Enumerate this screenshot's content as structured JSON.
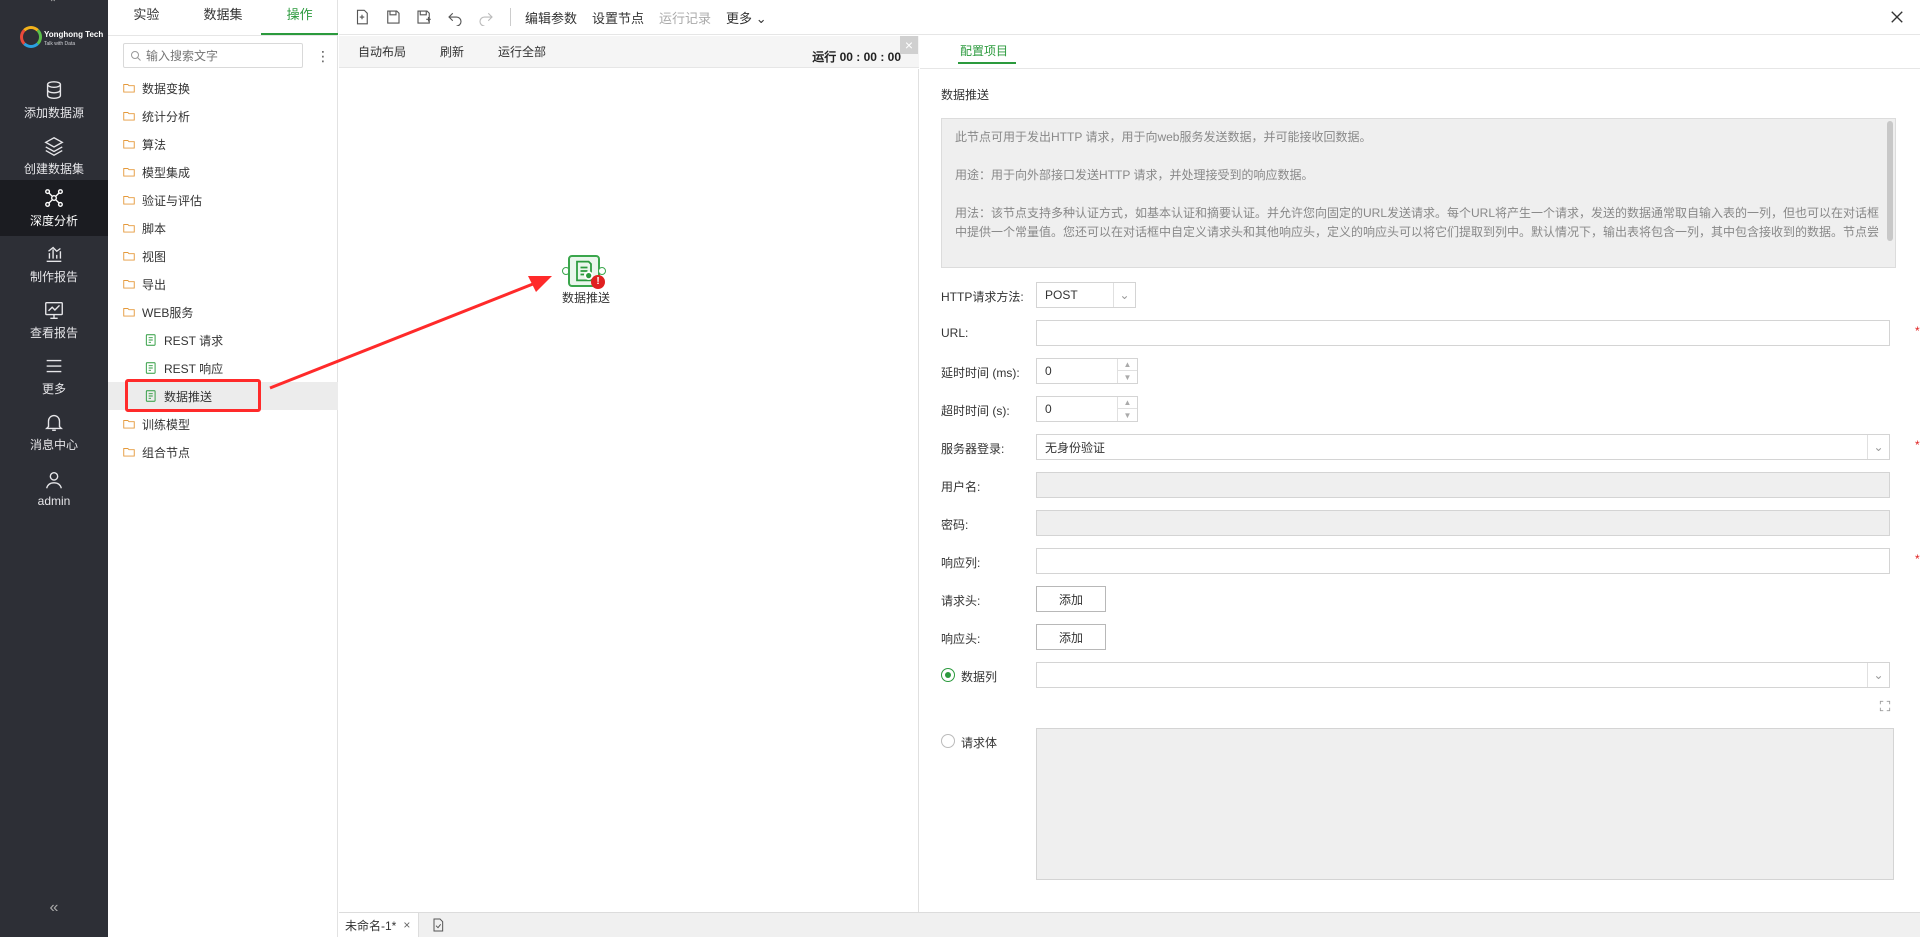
{
  "brand": {
    "name": "Yonghong Tech",
    "tagline": "Talk with Data"
  },
  "nav": {
    "items": [
      {
        "label": "添加数据源",
        "icon": "database-icon"
      },
      {
        "label": "创建数据集",
        "icon": "layers-icon"
      },
      {
        "label": "深度分析",
        "icon": "network-icon",
        "active": true
      },
      {
        "label": "制作报告",
        "icon": "chart-report-icon"
      },
      {
        "label": "查看报告",
        "icon": "monitor-chart-icon"
      },
      {
        "label": "更多",
        "icon": "menu-icon"
      },
      {
        "label": "消息中心",
        "icon": "bell-icon"
      },
      {
        "label": "admin",
        "icon": "user-icon"
      }
    ],
    "collapse": "«"
  },
  "tree": {
    "tabs": [
      "实验",
      "数据集",
      "操作"
    ],
    "active_tab": "操作",
    "search_placeholder": "输入搜索文字",
    "folders": [
      "数据变换",
      "统计分析",
      "算法",
      "模型集成",
      "验证与评估",
      "脚本",
      "视图",
      "导出",
      "WEB服务"
    ],
    "web_children": [
      "REST 请求",
      "REST 响应",
      "数据推送"
    ],
    "folders_after": [
      "训练模型",
      "组合节点"
    ]
  },
  "toolbar": {
    "actions": [
      "编辑参数",
      "设置节点",
      "运行记录",
      "更多"
    ],
    "disabled": [
      "运行记录"
    ]
  },
  "canvasbar": {
    "buttons": [
      "自动布局",
      "刷新",
      "运行全部"
    ],
    "timer_label": "运行",
    "timer_value": "00 : 00 : 00"
  },
  "canvas": {
    "node_label": "数据推送"
  },
  "bottom": {
    "doc_tab": "未命名-1*"
  },
  "props": {
    "tab": "配置项目",
    "section": "数据推送",
    "desc": [
      "此节点可用于发出HTTP 请求，用于向web服务发送数据，并可能接收回数据。",
      "用途：用于向外部接口发送HTTP 请求，并处理接受到的响应数据。",
      "用法：该节点支持多种认证方式，如基本认证和摘要认证。并允许您向固定的URL发送请求。每个URL将产生一个请求，发送的数据通常取自输入表的一列，但也可以在对话框中提供一个常量值。您还可以在对话框中自定义请求头和其他响应头，定义的响应头可以将它们提取到列中。默认情况下，输出表将包含一列，其中包含接收到的数据。节点尝"
    ],
    "fields": {
      "method_label": "HTTP请求方法:",
      "method_value": "POST",
      "url_label": "URL:",
      "delay_label": "延时时间 (ms):",
      "delay_value": "0",
      "timeout_label": "超时时间 (s):",
      "timeout_value": "0",
      "login_label": "服务器登录:",
      "login_value": "无身份验证",
      "user_label": "用户名:",
      "pwd_label": "密码:",
      "resp_col_label": "响应列:",
      "req_header_label": "请求头:",
      "resp_header_label": "响应头:",
      "add_label": "添加",
      "data_col_label": "数据列",
      "body_label": "请求体",
      "required_mark": "*"
    }
  },
  "colors": {
    "accent": "#2b9a3d",
    "nav_bg": "#2d2f36",
    "highlight": "#ff2a2a"
  }
}
